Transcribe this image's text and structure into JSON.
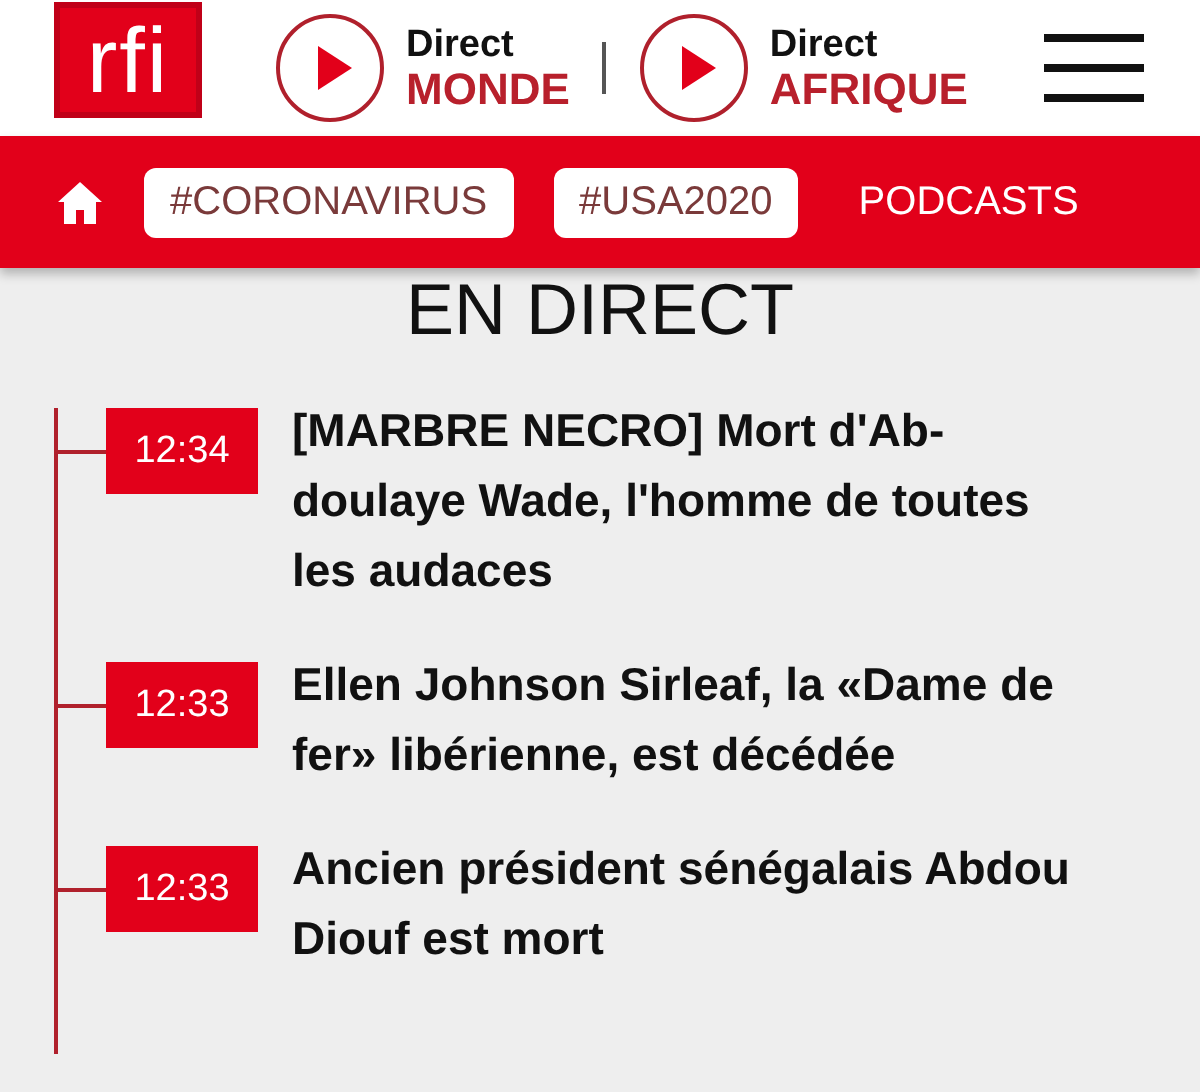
{
  "header": {
    "logo": "rfi",
    "live_links": [
      {
        "label": "Direct",
        "station": "MONDE"
      },
      {
        "label": "Direct",
        "station": "AFRIQUE"
      }
    ]
  },
  "nav": {
    "items": [
      {
        "kind": "home"
      },
      {
        "kind": "chip",
        "label": "#CORONAVIRUS"
      },
      {
        "kind": "chip",
        "label": "#USA2020"
      },
      {
        "kind": "link",
        "label": "PODCASTS"
      }
    ]
  },
  "section_title": "EN DIRECT",
  "live_feed": [
    {
      "time": "12:34",
      "headline": "[MARBRE NECRO] Mort d'Ab-doulaye Wade, l'homme de toutes les audaces"
    },
    {
      "time": "12:33",
      "headline": "Ellen Johnson Sirleaf, la «Dame de fer» libérienne, est décédée"
    },
    {
      "time": "12:33",
      "headline": "Ancien président sénégalais Abdou Diouf est mort"
    }
  ]
}
